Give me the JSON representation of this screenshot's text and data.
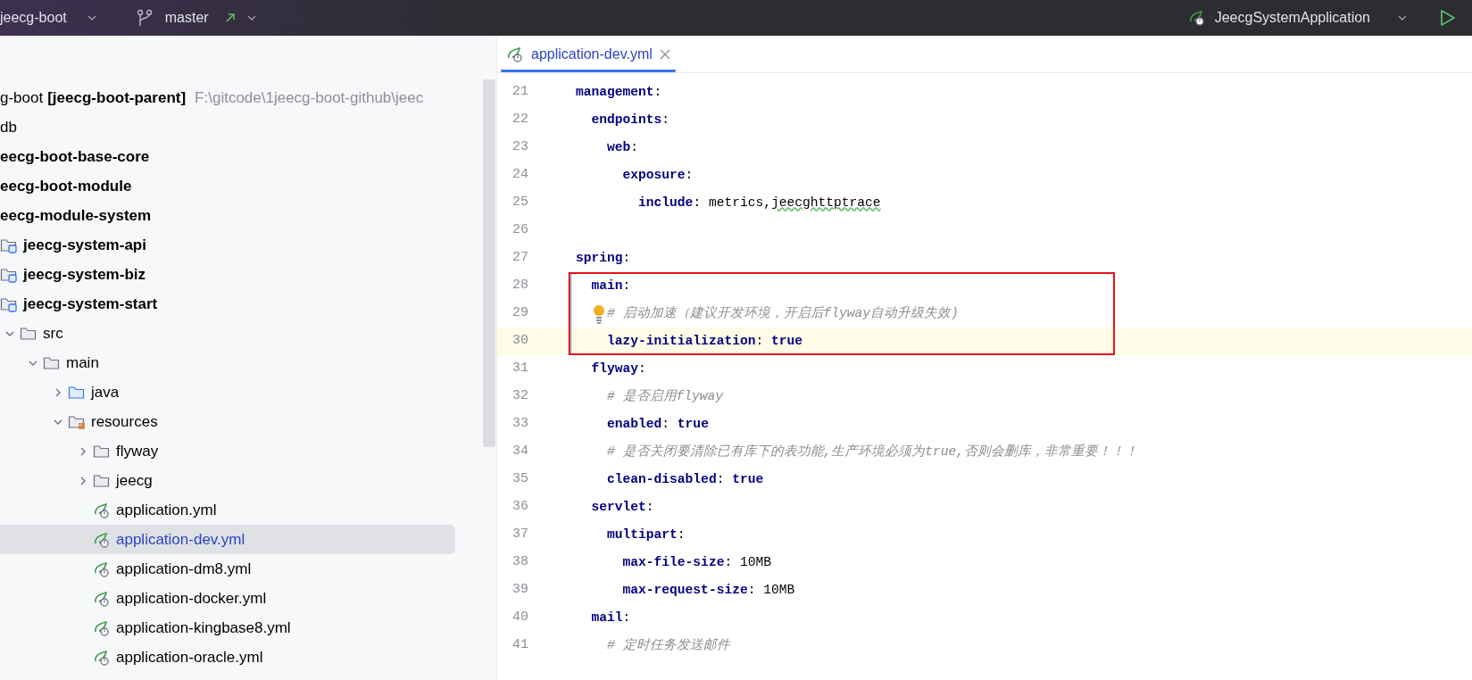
{
  "toolbar": {
    "project": "jeecg-boot",
    "branch": "master",
    "run_config": "JeecgSystemApplication"
  },
  "project_tree": [
    {
      "label": "g-boot",
      "module_label": "[jeecg-boot-parent]",
      "path": "F:\\gitcode\\1jeecg-boot-github\\jeec",
      "selected": false,
      "children": [
        {
          "label": "db",
          "selected": false
        },
        {
          "label": "eecg-boot-base-core",
          "kind": "module",
          "selected": false
        },
        {
          "label": "eecg-boot-module",
          "kind": "module",
          "selected": false
        },
        {
          "label": "eecg-module-system",
          "kind": "module",
          "selected": false,
          "children": [
            {
              "label": "jeecg-system-api",
              "kind": "module",
              "selected": false
            },
            {
              "label": "jeecg-system-biz",
              "kind": "module",
              "selected": false
            },
            {
              "label": "jeecg-system-start",
              "kind": "module",
              "selected": false,
              "children": [
                {
                  "label": "src",
                  "kind": "folder",
                  "expanded": true,
                  "selected": false,
                  "children": [
                    {
                      "label": "main",
                      "kind": "folder",
                      "expanded": true,
                      "selected": false,
                      "children": [
                        {
                          "label": "java",
                          "kind": "source_folder",
                          "expanded": false,
                          "selected": false
                        },
                        {
                          "label": "resources",
                          "kind": "resource_folder",
                          "expanded": true,
                          "selected": false,
                          "children": [
                            {
                              "label": "flyway",
                              "kind": "folder",
                              "expanded": false,
                              "selected": false
                            },
                            {
                              "label": "jeecg",
                              "kind": "folder",
                              "expanded": false,
                              "selected": false
                            },
                            {
                              "label": "application.yml",
                              "kind": "yml",
                              "selected": false
                            },
                            {
                              "label": "application-dev.yml",
                              "kind": "yml",
                              "selected": true
                            },
                            {
                              "label": "application-dm8.yml",
                              "kind": "yml",
                              "selected": false
                            },
                            {
                              "label": "application-docker.yml",
                              "kind": "yml",
                              "selected": false
                            },
                            {
                              "label": "application-kingbase8.yml",
                              "kind": "yml",
                              "selected": false
                            },
                            {
                              "label": "application-oracle.yml",
                              "kind": "yml",
                              "selected": false
                            }
                          ]
                        }
                      ]
                    }
                  ]
                }
              ]
            }
          ]
        }
      ]
    }
  ],
  "editor_tabs": [
    {
      "label": "application-dev.yml",
      "selected": true
    }
  ],
  "code_lines": [
    {
      "number": "21",
      "tokens": [
        {
          "text": "management",
          "kind": "key"
        },
        {
          "text": ":",
          "kind": "punct"
        }
      ]
    },
    {
      "number": "22",
      "tokens": [
        {
          "text": "  endpoints",
          "kind": "key"
        },
        {
          "text": ":",
          "kind": "punct"
        }
      ]
    },
    {
      "number": "23",
      "tokens": [
        {
          "text": "    web",
          "kind": "key"
        },
        {
          "text": ":",
          "kind": "punct"
        }
      ]
    },
    {
      "number": "24",
      "tokens": [
        {
          "text": "      exposure",
          "kind": "key"
        },
        {
          "text": ":",
          "kind": "punct"
        }
      ]
    },
    {
      "number": "25",
      "tokens": [
        {
          "text": "        include",
          "kind": "key"
        },
        {
          "text": ": ",
          "kind": "punct"
        },
        {
          "text": "metrics,",
          "kind": "value"
        },
        {
          "text": "jeecghttptrace",
          "kind": "typo"
        }
      ]
    },
    {
      "number": "26"
    },
    {
      "number": "27",
      "tokens": [
        {
          "text": "spring",
          "kind": "key"
        },
        {
          "text": ":",
          "kind": "punct"
        }
      ]
    },
    {
      "number": "28",
      "boxed": true,
      "modified": true,
      "tokens": [
        {
          "text": "  main",
          "kind": "key"
        },
        {
          "text": ":",
          "kind": "punct"
        }
      ]
    },
    {
      "number": "29",
      "boxed": true,
      "modified": true,
      "bulb": true,
      "tokens": [
        {
          "text": "    # 启动加速（建议开发环境，开启后flyway自动升级失效)",
          "kind": "comment"
        }
      ]
    },
    {
      "number": "30",
      "boxed": true,
      "modified": true,
      "current": true,
      "tokens": [
        {
          "text": "    lazy-initialization",
          "kind": "key"
        },
        {
          "text": ": ",
          "kind": "punct"
        },
        {
          "text": "true",
          "kind": "bool"
        }
      ]
    },
    {
      "number": "31",
      "tokens": [
        {
          "text": "  flyway",
          "kind": "key"
        },
        {
          "text": ":",
          "kind": "punct"
        }
      ]
    },
    {
      "number": "32",
      "tokens": [
        {
          "text": "    # 是否启用flyway",
          "kind": "comment"
        }
      ]
    },
    {
      "number": "33",
      "tokens": [
        {
          "text": "    enabled",
          "kind": "key"
        },
        {
          "text": ": ",
          "kind": "punct"
        },
        {
          "text": "true",
          "kind": "bool"
        }
      ]
    },
    {
      "number": "34",
      "tokens": [
        {
          "text": "    # 是否关闭要清除已有库下的表功能,生产环境必须为true,否则会删库，非常重要！！！",
          "kind": "comment"
        }
      ]
    },
    {
      "number": "35",
      "tokens": [
        {
          "text": "    clean-disabled",
          "kind": "key"
        },
        {
          "text": ": ",
          "kind": "punct"
        },
        {
          "text": "true",
          "kind": "bool"
        }
      ]
    },
    {
      "number": "36",
      "tokens": [
        {
          "text": "  servlet",
          "kind": "key"
        },
        {
          "text": ":",
          "kind": "punct"
        }
      ]
    },
    {
      "number": "37",
      "tokens": [
        {
          "text": "    multipart",
          "kind": "key"
        },
        {
          "text": ":",
          "kind": "punct"
        }
      ]
    },
    {
      "number": "38",
      "tokens": [
        {
          "text": "      max-file-size",
          "kind": "key"
        },
        {
          "text": ": ",
          "kind": "punct"
        },
        {
          "text": "10MB",
          "kind": "value"
        }
      ]
    },
    {
      "number": "39",
      "tokens": [
        {
          "text": "      max-request-size",
          "kind": "key"
        },
        {
          "text": ": ",
          "kind": "punct"
        },
        {
          "text": "10MB",
          "kind": "value"
        }
      ]
    },
    {
      "number": "40",
      "tokens": [
        {
          "text": "  mail",
          "kind": "key"
        },
        {
          "text": ":",
          "kind": "punct"
        }
      ]
    },
    {
      "number": "41",
      "tokens": [
        {
          "text": "    # 定时任务发送邮件",
          "kind": "comment"
        }
      ]
    }
  ]
}
